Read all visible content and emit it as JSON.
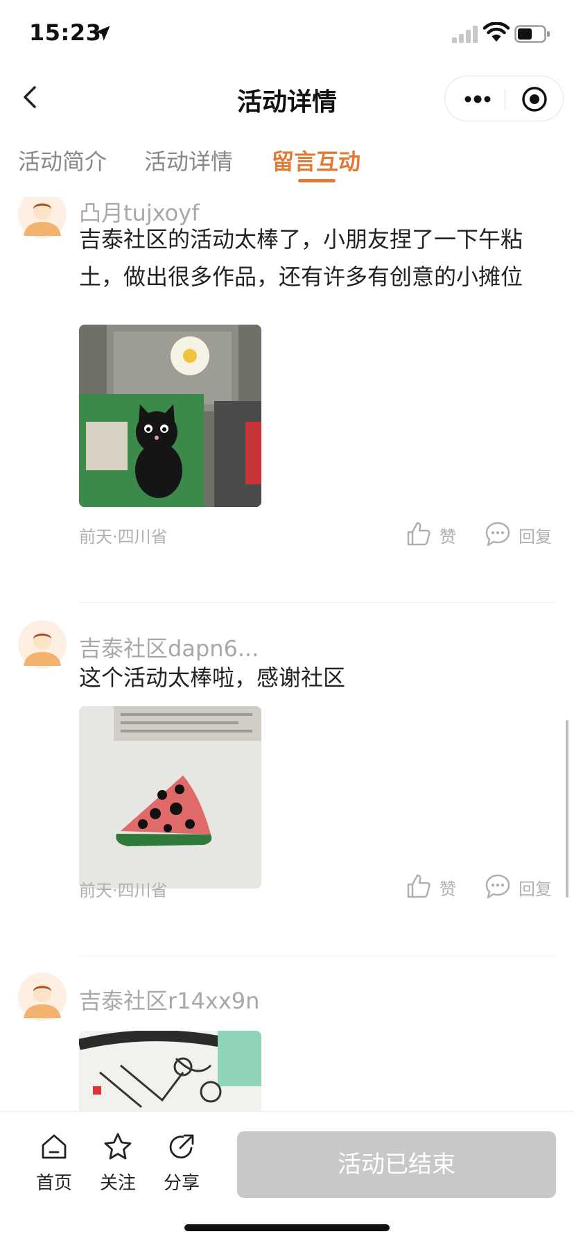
{
  "status_bar": {
    "time": "15:23"
  },
  "nav": {
    "title": "活动详情"
  },
  "tabs": [
    {
      "label": "活动简介"
    },
    {
      "label": "活动详情"
    },
    {
      "label": "留言互动"
    }
  ],
  "accent_color": "#e07a34",
  "comments": [
    {
      "name": "凸月tujxoyf",
      "text": "吉泰社区的活动太棒了，小朋友捏了一下午粘土，做出很多作品，还有许多有创意的小摊位",
      "meta": "前天·四川省",
      "like_label": "赞",
      "reply_label": "回复"
    },
    {
      "name": "吉泰社区dapn6...",
      "text": "这个活动太棒啦，感谢社区",
      "meta": "前天·四川省",
      "like_label": "赞",
      "reply_label": "回复"
    },
    {
      "name": "吉泰社区r14xx9n"
    }
  ],
  "bottom_bar": {
    "home_label": "首页",
    "follow_label": "关注",
    "share_label": "分享",
    "status_button": "活动已结束"
  }
}
